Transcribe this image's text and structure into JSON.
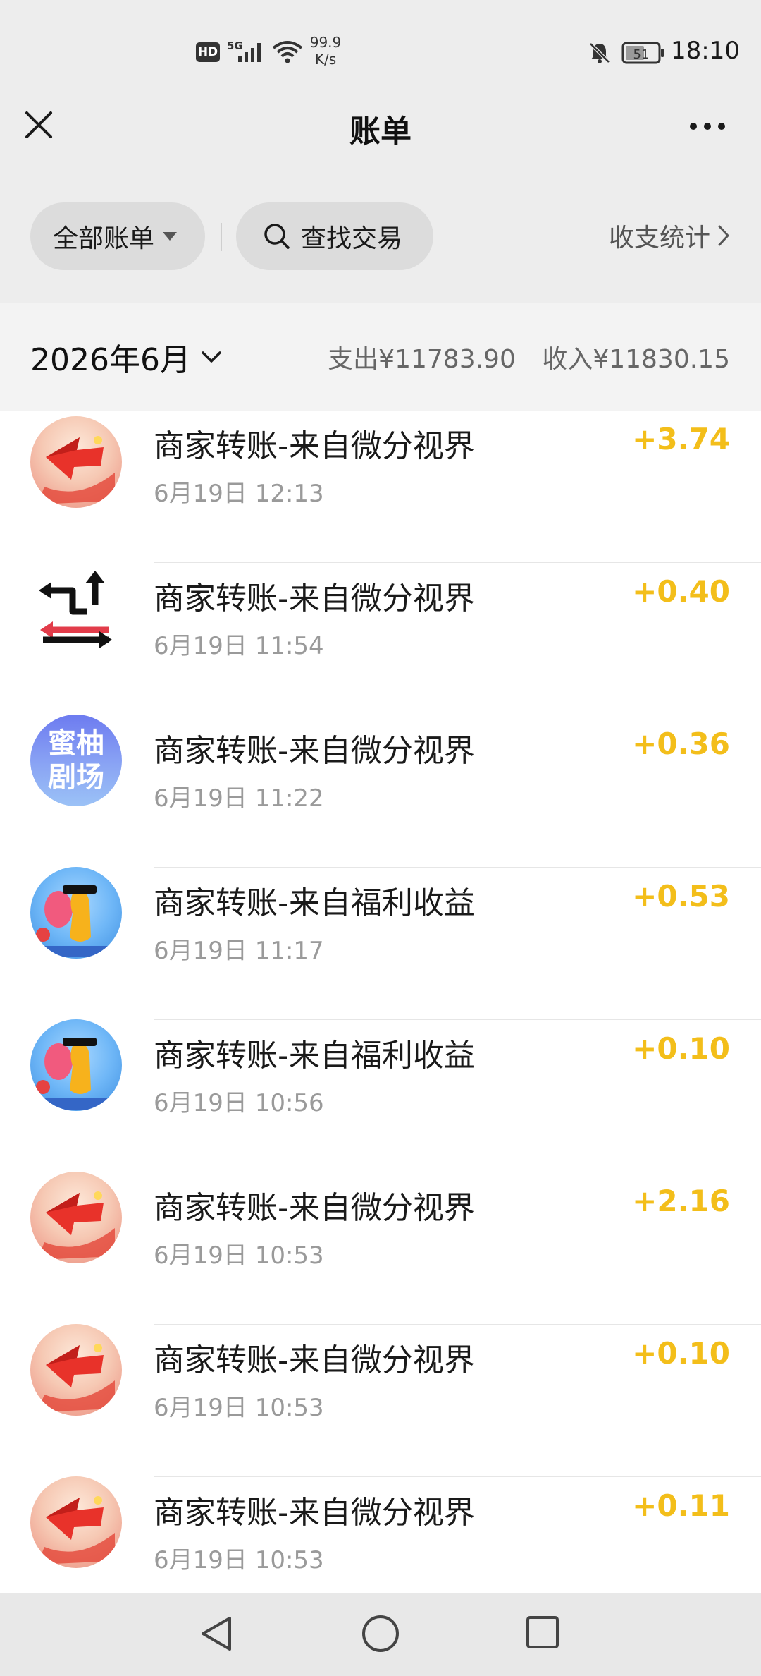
{
  "status_bar": {
    "hd": "HD",
    "network": "5G",
    "speed_value": "99.9",
    "speed_unit": "K/s",
    "battery": "51",
    "time": "18:10"
  },
  "nav": {
    "title": "账单"
  },
  "filters": {
    "all_bills": "全部账单",
    "search": "查找交易",
    "stats": "收支统计"
  },
  "month": {
    "label": "2026年6月",
    "expense": "支出¥11783.90",
    "income": "收入¥11830.15"
  },
  "transactions": [
    {
      "title": "商家转账-来自微分视界",
      "time": "6月19日 12:13",
      "amount": "+3.74",
      "icon": "red-arrow-icon"
    },
    {
      "title": "商家转账-来自微分视界",
      "time": "6月19日 11:54",
      "amount": "+0.40",
      "icon": "exchange-icon"
    },
    {
      "title": "商家转账-来自微分视界",
      "time": "6月19日 11:22",
      "amount": "+0.36",
      "icon": "honey-pomelo-theater-icon",
      "avatar_text_1": "蜜柚",
      "avatar_text_2": "剧场"
    },
    {
      "title": "商家转账-来自福利收益",
      "time": "6月19日 11:17",
      "amount": "+0.53",
      "icon": "game-character-icon"
    },
    {
      "title": "商家转账-来自福利收益",
      "time": "6月19日 10:56",
      "amount": "+0.10",
      "icon": "game-character-icon"
    },
    {
      "title": "商家转账-来自微分视界",
      "time": "6月19日 10:53",
      "amount": "+2.16",
      "icon": "red-arrow-icon"
    },
    {
      "title": "商家转账-来自微分视界",
      "time": "6月19日 10:53",
      "amount": "+0.10",
      "icon": "red-arrow-icon"
    },
    {
      "title": "商家转账-来自微分视界",
      "time": "6月19日 10:53",
      "amount": "+0.11",
      "icon": "red-arrow-icon"
    }
  ],
  "colors": {
    "amount": "#f3be1a",
    "header_bg": "#ededed"
  }
}
